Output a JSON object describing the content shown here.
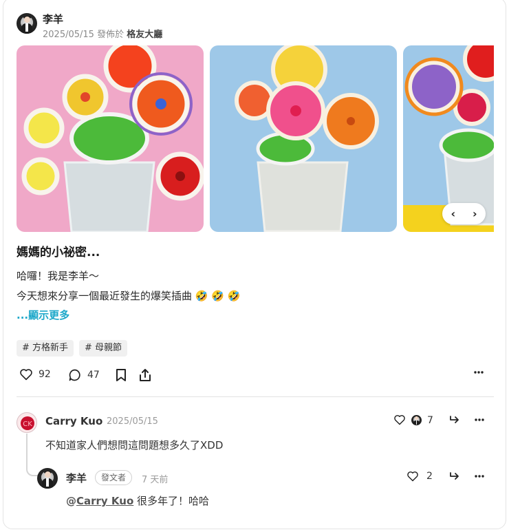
{
  "post": {
    "author": "李羊",
    "date": "2025/05/15",
    "posted_in": "發佈於",
    "board": "格友大廳",
    "title": "媽媽的小祕密...",
    "body_line1": "哈囉！我是李羊～",
    "body_line2": "今天想來分享一個最近發生的爆笑插曲 🤣 🤣 🤣",
    "show_more": "...顯示更多",
    "tags": [
      "# 方格新手",
      "# 母親節"
    ],
    "likes": "92",
    "comments": "47",
    "gallery_nav": {
      "prev": "‹",
      "next": "›"
    }
  },
  "comments": [
    {
      "author": "Carry Kuo",
      "date": "2025/05/15",
      "text": "不知道家人們想問這問題想多久了XDD",
      "likes": "7"
    }
  ],
  "reply": {
    "author": "李羊",
    "badge": "發文者",
    "time": "7 天前",
    "mention_prefix": "@",
    "mention": "Carry Kuo",
    "text": " 很多年了！哈哈",
    "likes": "2"
  },
  "colors": {
    "accent": "#1da7c9",
    "divider": "#e3e3e3"
  },
  "icons": [
    "heart-icon",
    "comment-icon",
    "bookmark-icon",
    "share-icon",
    "more-icon",
    "reply-icon"
  ]
}
